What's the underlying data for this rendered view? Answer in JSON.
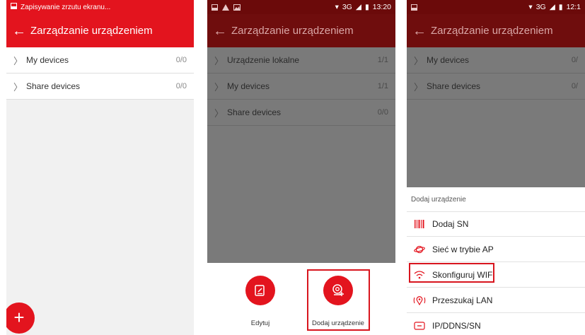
{
  "colors": {
    "brand_red": "#e3141e",
    "dim_gray": "#7a7a7a"
  },
  "screen1": {
    "status_text": "Zapisywanie zrzutu ekranu...",
    "title": "Zarządzanie urządzeniem",
    "rows": [
      {
        "label": "My devices",
        "count": "0/0"
      },
      {
        "label": "Share devices",
        "count": "0/0"
      }
    ],
    "fab_symbol": "+"
  },
  "screen2": {
    "network": "3G",
    "time": "13:20",
    "title": "Zarządzanie urządzeniem",
    "rows": [
      {
        "label": "Urządzenie lokalne",
        "count": "1/1"
      },
      {
        "label": "My devices",
        "count": "1/1"
      },
      {
        "label": "Share devices",
        "count": "0/0"
      }
    ],
    "actions": [
      {
        "label": "Edytuj",
        "icon": "edit-icon"
      },
      {
        "label": "Dodaj urządzenie",
        "icon": "add-camera-icon"
      }
    ]
  },
  "screen3": {
    "network": "3G",
    "time": "12:1",
    "title": "Zarządzanie urządzeniem",
    "rows": [
      {
        "label": "My devices",
        "count": "0/"
      },
      {
        "label": "Share devices",
        "count": "0/"
      }
    ],
    "sheet_title": "Dodaj urządzenie",
    "options": [
      {
        "label": "Dodaj SN",
        "icon": "barcode-icon"
      },
      {
        "label": "Sieć w trybie AP",
        "icon": "planet-icon"
      },
      {
        "label": "Skonfiguruj WIFI",
        "icon": "wifi-icon"
      },
      {
        "label": "Przeszukaj LAN",
        "icon": "location-pin-icon"
      },
      {
        "label": "IP/DDNS/SN",
        "icon": "ip-icon"
      }
    ]
  }
}
